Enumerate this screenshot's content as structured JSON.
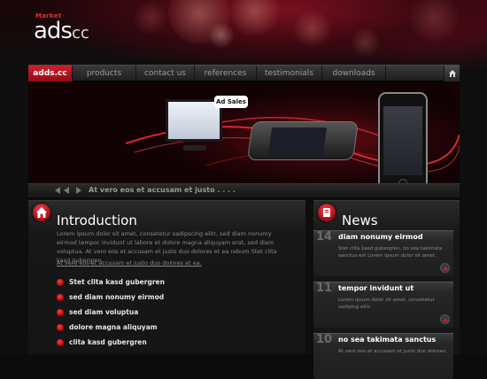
{
  "logo": {
    "tag": "Market",
    "word": "ads",
    "suffix": "cc"
  },
  "nav": {
    "items": [
      {
        "label": "adds.cc",
        "active": true
      },
      {
        "label": "products"
      },
      {
        "label": "contact us"
      },
      {
        "label": "references"
      },
      {
        "label": "testimonials"
      },
      {
        "label": "downloads"
      }
    ],
    "home_icon": "home-icon"
  },
  "hero": {
    "badge": "Ad Sales",
    "caption": "At vero eos et accusam et justo . . . ."
  },
  "intro": {
    "title": "Introduction",
    "body": "Lorem ipsum dolor sit amet, consetetur sadipscing elitr, sed diam nonumy eirmod tempor invidunt ut labore et dolore magna aliquyam erat, sed diam voluptua. At vero eos et accusam et justo duo dolores et ea rebum Stet clita kasd gubergren.",
    "link": "At vero eos et accusam et justo duo dolores et ea.",
    "list": [
      "Stet clita kasd gubergren",
      "sed diam nonumy eirmod",
      "sed diam voluptua",
      "dolore magna aliquyam",
      "clita kasd gubergren"
    ]
  },
  "news": {
    "title": "News",
    "items": [
      {
        "day": "14",
        "head": "diam nonumy eirmod",
        "body": "Stet clita kasd gubergren, no sea takimata sanctus est Lorem ipsum dolor sit amet."
      },
      {
        "day": "11",
        "head": "tempor invidunt ut",
        "body": "Lorem ipsum dolor sit amet, consetetur sadiping elitr."
      },
      {
        "day": "10",
        "head": "no sea takimata sanctus",
        "body": "At vero eos et accusam et justo duo dolores."
      }
    ]
  },
  "colors": {
    "accent": "#d31d2a",
    "background": "#0e0e0e",
    "panel": "#1a1a1a"
  }
}
